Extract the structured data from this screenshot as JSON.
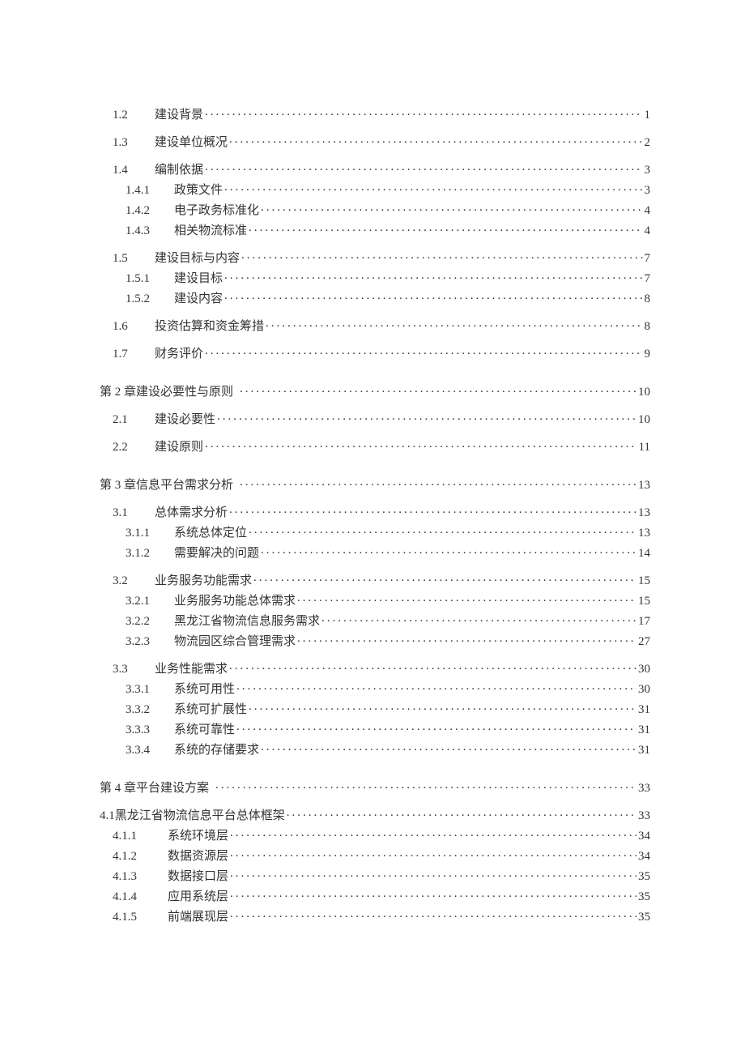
{
  "toc": [
    {
      "num": "1.2",
      "title": "建设背景",
      "page": "1",
      "level": 1,
      "gap_after": 15
    },
    {
      "num": "1.3",
      "title": "建设单位概况",
      "page": "2",
      "level": 1,
      "gap_after": 15
    },
    {
      "num": "1.4",
      "title": "编制依据",
      "page": "3",
      "level": 1,
      "gap_after": 6
    },
    {
      "num": "1.4.1",
      "title": "政策文件",
      "page": "3",
      "level": 2,
      "gap_after": 6
    },
    {
      "num": "1.4.2",
      "title": "电子政务标准化",
      "page": "4",
      "level": 2,
      "gap_after": 6
    },
    {
      "num": "1.4.3",
      "title": "相关物流标准",
      "page": "4",
      "level": 2,
      "gap_after": 15
    },
    {
      "num": "1.5",
      "title": "建设目标与内容",
      "page": "7",
      "level": 1,
      "gap_after": 6
    },
    {
      "num": "1.5.1",
      "title": "建设目标",
      "page": "7",
      "level": 2,
      "gap_after": 6
    },
    {
      "num": "1.5.2",
      "title": "建设内容",
      "page": "8",
      "level": 2,
      "gap_after": 15
    },
    {
      "num": "1.6",
      "title": "投资估算和资金筹措",
      "page": "8",
      "level": 1,
      "gap_after": 15
    },
    {
      "num": "1.7",
      "title": "财务评价",
      "page": "9",
      "level": 1,
      "gap_after": 28
    },
    {
      "num": "第 2 章",
      "title": "建设必要性与原则",
      "page": "10",
      "level": 0,
      "gap_after": 15
    },
    {
      "num": "2.1",
      "title": "建设必要性",
      "page": "10",
      "level": 1,
      "gap_after": 15
    },
    {
      "num": "2.2",
      "title": "建设原则",
      "page": "11",
      "level": 1,
      "gap_after": 28
    },
    {
      "num": "第 3 章",
      "title": "信息平台需求分析",
      "page": "13",
      "level": 0,
      "gap_after": 15
    },
    {
      "num": "3.1",
      "title": "总体需求分析",
      "page": "13",
      "level": 1,
      "gap_after": 6
    },
    {
      "num": "3.1.1",
      "title": "系统总体定位",
      "page": "13",
      "level": 2,
      "gap_after": 6
    },
    {
      "num": "3.1.2",
      "title": "需要解决的问题",
      "page": "14",
      "level": 2,
      "gap_after": 15
    },
    {
      "num": "3.2",
      "title": "业务服务功能需求",
      "page": "15",
      "level": 1,
      "gap_after": 6
    },
    {
      "num": "3.2.1",
      "title": "业务服务功能总体需求",
      "page": "15",
      "level": 2,
      "gap_after": 6
    },
    {
      "num": "3.2.2",
      "title": "黑龙江省物流信息服务需求",
      "page": "17",
      "level": 2,
      "gap_after": 6
    },
    {
      "num": "3.2.3",
      "title": "物流园区综合管理需求",
      "page": "27",
      "level": 2,
      "gap_after": 15
    },
    {
      "num": "3.3",
      "title": "业务性能需求",
      "page": "30",
      "level": 1,
      "gap_after": 6
    },
    {
      "num": "3.3.1",
      "title": "系统可用性",
      "page": "30",
      "level": 2,
      "gap_after": 6
    },
    {
      "num": "3.3.2",
      "title": "系统可扩展性",
      "page": "31",
      "level": 2,
      "gap_after": 6
    },
    {
      "num": "3.3.3",
      "title": "系统可靠性",
      "page": "31",
      "level": 2,
      "gap_after": 6
    },
    {
      "num": "3.3.4",
      "title": "系统的存储要求",
      "page": "31",
      "level": 2,
      "gap_after": 28
    },
    {
      "num": "第 4 章",
      "title": "平台建设方案",
      "page": "33",
      "level": 0,
      "gap_after": 15
    },
    {
      "num": "4.1",
      "title": "黑龙江省物流信息平台总体框架",
      "page": "33",
      "level": 0,
      "gap_after": 6
    },
    {
      "num": "4.1.1",
      "title": "系统环境层",
      "page": "34",
      "level": 1,
      "gap_after": 6,
      "numw": "w-l2b"
    },
    {
      "num": "4.1.2",
      "title": "数据资源层",
      "page": "34",
      "level": 1,
      "gap_after": 6,
      "numw": "w-l2b"
    },
    {
      "num": "4.1.3",
      "title": "数据接口层",
      "page": "35",
      "level": 1,
      "gap_after": 6,
      "numw": "w-l2b"
    },
    {
      "num": "4.1.4",
      "title": "应用系统层",
      "page": "35",
      "level": 1,
      "gap_after": 6,
      "numw": "w-l2b"
    },
    {
      "num": "4.1.5",
      "title": "前端展现层",
      "page": "35",
      "level": 1,
      "gap_after": 0,
      "numw": "w-l2b"
    }
  ]
}
